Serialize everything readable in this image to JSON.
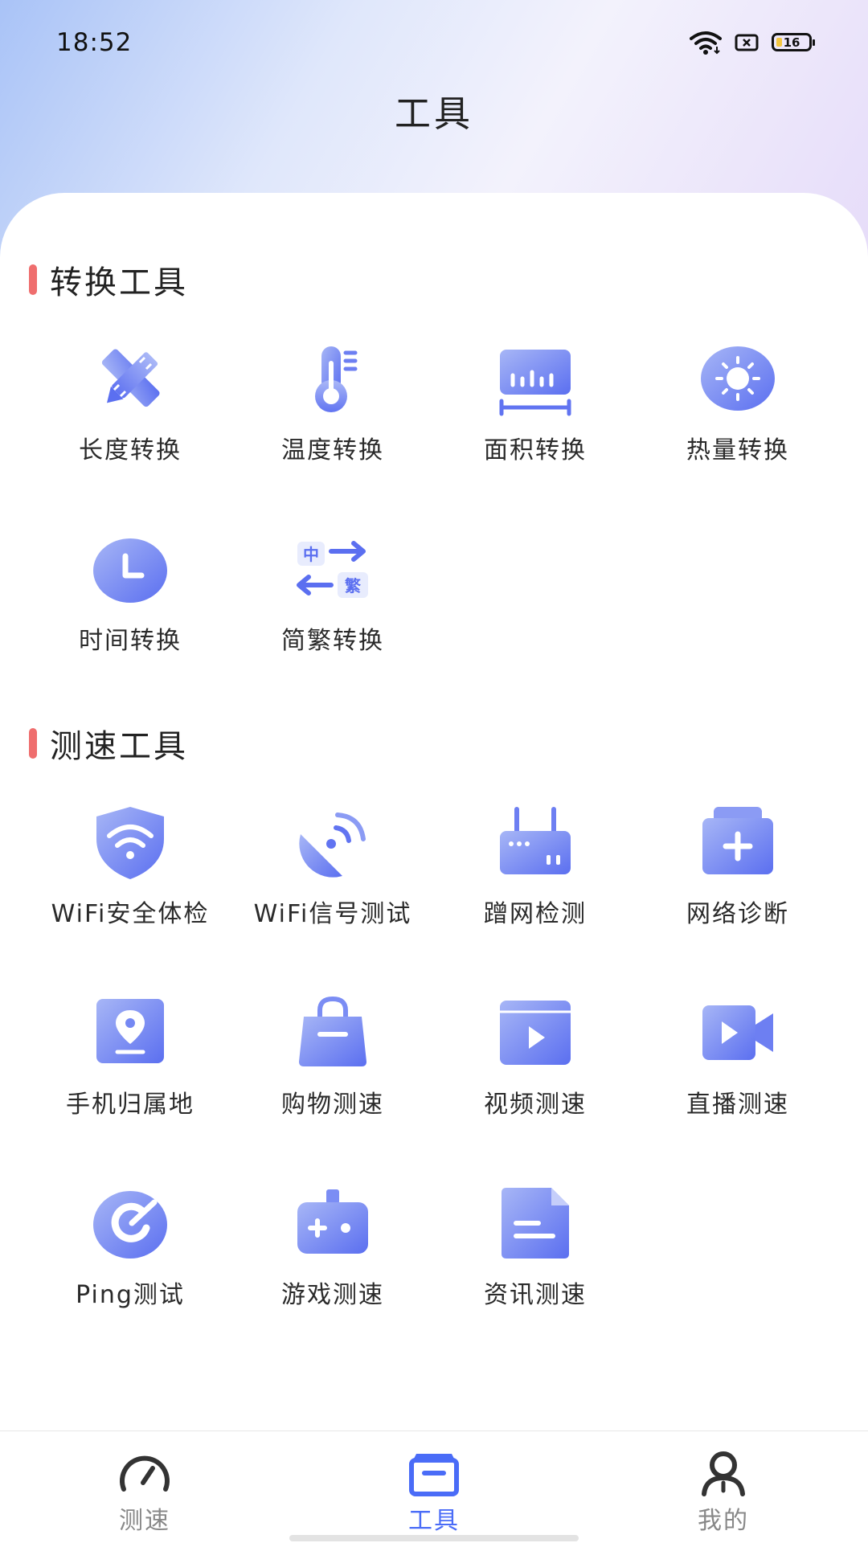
{
  "status_bar": {
    "time": "18:52",
    "battery": "16"
  },
  "header": {
    "title": "工具"
  },
  "sections": {
    "convert": {
      "title": "转换工具",
      "tools": [
        {
          "label": "长度转换",
          "icon": "ruler-pencil-icon"
        },
        {
          "label": "温度转换",
          "icon": "thermometer-icon"
        },
        {
          "label": "面积转换",
          "icon": "area-ruler-icon"
        },
        {
          "label": "热量转换",
          "icon": "sun-icon"
        },
        {
          "label": "时间转换",
          "icon": "clock-icon"
        },
        {
          "label": "简繁转换",
          "icon": "chinese-convert-icon",
          "glyph_top": "中",
          "glyph_bottom": "繁"
        }
      ]
    },
    "speed": {
      "title": "测速工具",
      "tools": [
        {
          "label": "WiFi安全体检",
          "icon": "wifi-shield-icon"
        },
        {
          "label": "WiFi信号测试",
          "icon": "satellite-dish-icon"
        },
        {
          "label": "蹭网检测",
          "icon": "router-icon"
        },
        {
          "label": "网络诊断",
          "icon": "medical-kit-icon"
        },
        {
          "label": "手机归属地",
          "icon": "location-card-icon"
        },
        {
          "label": "购物测速",
          "icon": "shopping-bag-icon"
        },
        {
          "label": "视频测速",
          "icon": "video-player-icon"
        },
        {
          "label": "直播测速",
          "icon": "video-camera-icon"
        },
        {
          "label": "Ping测试",
          "icon": "ping-gauge-icon"
        },
        {
          "label": "游戏测速",
          "icon": "gamepad-icon"
        },
        {
          "label": "资讯测速",
          "icon": "document-icon"
        }
      ]
    }
  },
  "bottom_nav": [
    {
      "label": "测速",
      "icon": "speedometer-icon",
      "active": false
    },
    {
      "label": "工具",
      "icon": "toolbox-icon",
      "active": true
    },
    {
      "label": "我的",
      "icon": "user-icon",
      "active": false
    }
  ],
  "colors": {
    "accent": "#4a6cf7",
    "icon_start": "#9fb0f5",
    "icon_end": "#5b6ff0",
    "section_bar": "#ef6e6e"
  }
}
